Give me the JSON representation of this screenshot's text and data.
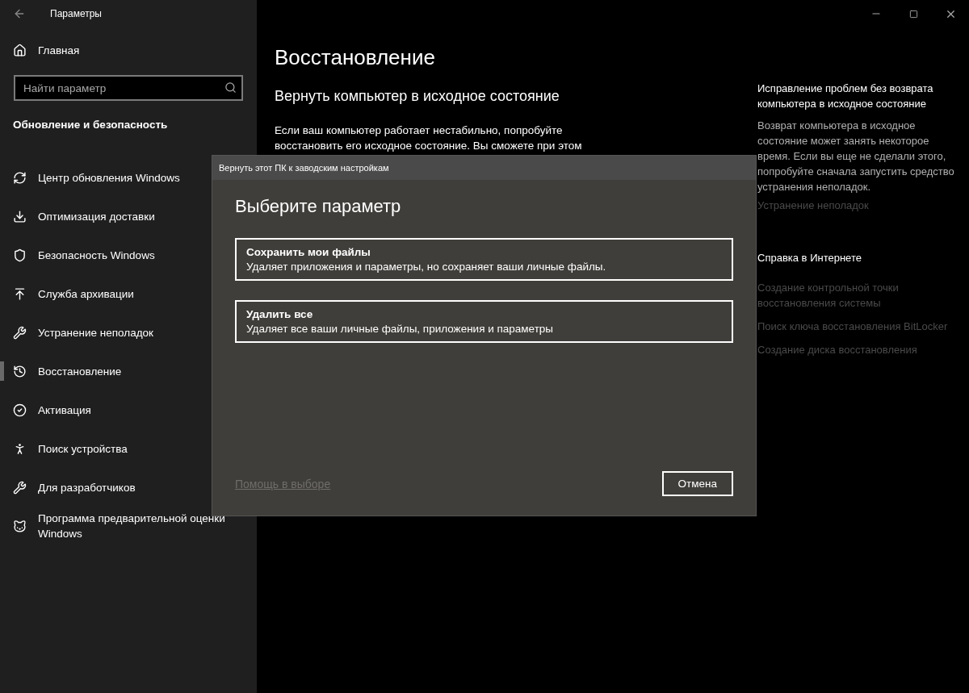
{
  "window": {
    "title": "Параметры"
  },
  "sidebar": {
    "home": "Главная",
    "search": {
      "placeholder": "Найти параметр"
    },
    "section": "Обновление и безопасность",
    "items": [
      {
        "label": "Центр обновления Windows",
        "selected": false
      },
      {
        "label": "Оптимизация доставки",
        "selected": false
      },
      {
        "label": "Безопасность Windows",
        "selected": false
      },
      {
        "label": "Служба архивации",
        "selected": false
      },
      {
        "label": "Устранение неполадок",
        "selected": false
      },
      {
        "label": "Восстановление",
        "selected": true
      },
      {
        "label": "Активация",
        "selected": false
      },
      {
        "label": "Поиск устройства",
        "selected": false
      },
      {
        "label": "Для разработчиков",
        "selected": false
      },
      {
        "label": "Программа предварительной оценки Windows",
        "selected": false
      }
    ]
  },
  "main": {
    "title": "Восстановление",
    "section_title": "Вернуть компьютер в исходное состояние",
    "paragraph": "Если ваш компьютер работает нестабильно, попробуйте восстановить его исходное состояние. Вы сможете при этом"
  },
  "aside": {
    "title": "Исправление проблем без возврата компьютера в исходное состояние",
    "text": "Возврат компьютера в исходное состояние может занять некоторое время. Если вы еще не сделали этого, попробуйте сначала запустить средство устранения неполадок.",
    "link": "Устранение неполадок",
    "help_title": "Справка в Интернете",
    "help_links": [
      "Создание контрольной точки восстановления системы",
      "Поиск ключа восстановления BitLocker",
      "Создание диска восстановления"
    ]
  },
  "dialog": {
    "title": "Вернуть этот ПК к заводским настройкам",
    "heading": "Выберите параметр",
    "options": [
      {
        "title": "Сохранить мои файлы",
        "description": "Удаляет приложения и параметры, но сохраняет ваши личные файлы."
      },
      {
        "title": "Удалить все",
        "description": "Удаляет все ваши личные файлы, приложения и параметры"
      }
    ],
    "help_link": {
      "label": "Помощь в выборе",
      "disabled": true
    },
    "cancel": "Отмена"
  }
}
